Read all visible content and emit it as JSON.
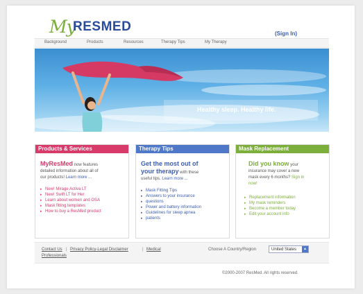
{
  "header": {
    "logo_my": "My",
    "logo_res": "RESMED",
    "sign_in": "(Sign In)"
  },
  "nav": {
    "items": [
      "Background",
      "Products",
      "Resources",
      "Therapy Tips",
      "My Therapy"
    ]
  },
  "hero": {
    "tagline": "Healthy sleep. Healthy life."
  },
  "panels": {
    "products": {
      "header": "Products & Services",
      "color": "#d83a6a",
      "intro_bold": "MyResMed",
      "intro_rest": " now features",
      "line2": "detailed information about all of",
      "line3_text": "our products! ",
      "line3_link": "Learn more ...",
      "bullets": [
        "New! Mirage Activa LT",
        "New! Swift LT for Her",
        "Learn about women and OSA",
        "Mask fitting templates",
        "How to buy a ResMed product"
      ]
    },
    "tips": {
      "header": "Therapy Tips",
      "color": "#4f78c8",
      "title1": "Get the most out of",
      "title2_bold": "your therapy",
      "title2_rest": " with these",
      "line3_text": "useful tips. ",
      "line3_link": "Learn more ...",
      "bullets": [
        "Mask Fitting Tips",
        "Answers to your insurance",
        "questions",
        "Power and battery information",
        "Guidelines for sleep apnea",
        "patients"
      ]
    },
    "mask": {
      "header": "Mask Replacement",
      "color": "#7cae3c",
      "title_bold": "Did you know",
      "title_rest": " your",
      "line2": "insurance may cover a new",
      "line3_text": "mask every 6 months? ",
      "line3_link": "Sign in",
      "line4_link": "now!",
      "bullets": [
        "Replacement information",
        "My mask reminders",
        "Become a member today",
        "Edit your account info"
      ]
    }
  },
  "footer": {
    "contact": "Contact Us",
    "privacy": "Privacy Policy-Legal Disclaimer",
    "medical1": "Medical",
    "medical2": "Professionals",
    "country_label": "Choose A Country/Region",
    "country_value": "United States",
    "separator": "|",
    "copyright": "©2000-2007 ResMed. All rights reserved."
  },
  "colors": {
    "accent_blue": "#3c5db0",
    "brand_green": "#7cae3c",
    "products_pink": "#d83a6a",
    "tips_blue": "#4f78c8",
    "mask_green": "#7cae3c"
  },
  "icons": {
    "bullet": "triangle-bullet-icon",
    "select_arrow": "dropdown-arrow-icon"
  }
}
